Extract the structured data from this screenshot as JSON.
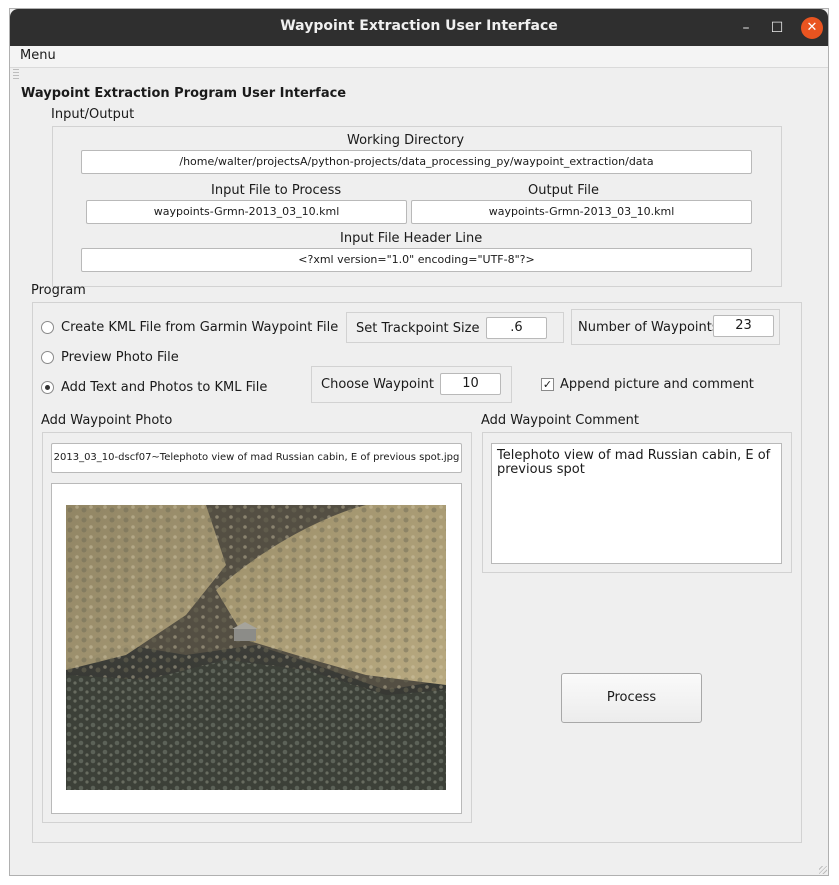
{
  "window": {
    "title": "Waypoint Extraction User Interface"
  },
  "menubar": {
    "menu": "Menu"
  },
  "app_heading": "Waypoint Extraction Program User Interface",
  "io": {
    "group_label": "Input/Output",
    "working_dir_label": "Working Directory",
    "working_dir_value": "/home/walter/projectsA/python-projects/data_processing_py/waypoint_extraction/data",
    "input_file_label": "Input File to Process",
    "input_file_value": "waypoints-Grmn-2013_03_10.kml",
    "output_file_label": "Output File",
    "output_file_value": "waypoints-Grmn-2013_03_10.kml",
    "header_line_label": "Input File Header Line",
    "header_line_value": "<?xml version=\"1.0\" encoding=\"UTF-8\"?>"
  },
  "program": {
    "group_label": "Program",
    "radio_create": "Create KML File from Garmin Waypoint File",
    "radio_preview": "Preview Photo File",
    "radio_add": "Add Text and Photos to KML File",
    "selected_option": "Add Text and Photos to KML File",
    "trackpoint_label": "Set Trackpoint Size",
    "trackpoint_value": ".6",
    "num_waypoints_label": "Number of Waypoints",
    "num_waypoints_value": "23",
    "choose_waypoint_label": "Choose Waypoint",
    "choose_waypoint_value": "10",
    "append_label": "Append picture and comment",
    "append_checked": true,
    "photo_label": "Add Waypoint Photo",
    "photo_filename": "2013_03_10-dscf07~Telephoto view of mad Russian cabin, E of previous spot.jpg",
    "comment_label": "Add Waypoint Comment",
    "comment_text": "Telephoto view of mad Russian cabin, E of previous spot",
    "process_button": "Process"
  },
  "icons": {
    "minimize": "minimize-icon",
    "maximize": "maximize-icon",
    "close": "close-icon",
    "check": "checkmark-icon"
  },
  "colors": {
    "titlebar": "#2f2f2f",
    "close_button": "#e95420",
    "window_bg": "#efefef"
  }
}
